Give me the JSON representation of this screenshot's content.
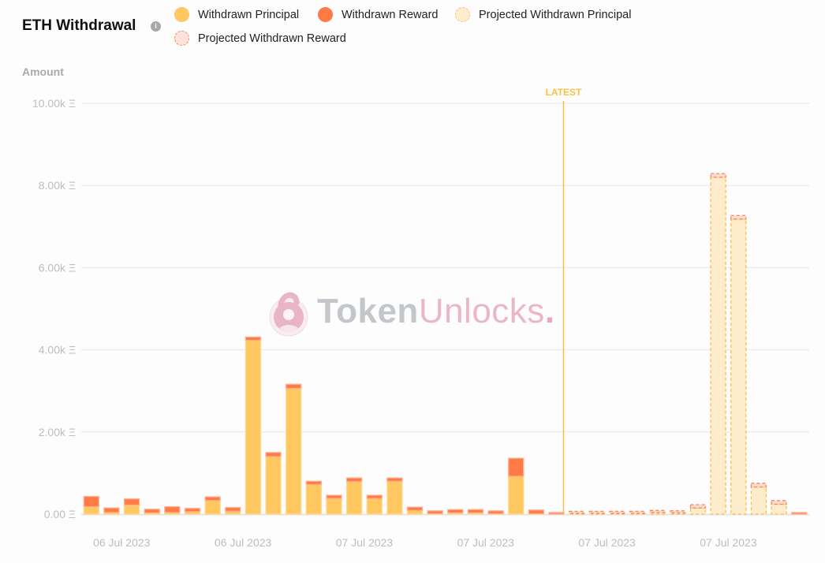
{
  "header": {
    "title": "ETH Withdrawal",
    "info_icon": "info-icon"
  },
  "legend": [
    {
      "label": "Withdrawn Principal",
      "color": "#ffc75f",
      "style": "solid"
    },
    {
      "label": "Withdrawn Reward",
      "color": "#ff7a45",
      "style": "solid"
    },
    {
      "label": "Projected Withdrawn Principal",
      "color": "#ffe9c4",
      "style": "dashed"
    },
    {
      "label": "Projected Withdrawn Reward",
      "color": "#ffe0d6",
      "style": "dashed"
    }
  ],
  "watermark": {
    "part1": "Token",
    "part2": "Unlocks",
    "dot": "."
  },
  "colors": {
    "principal": "#ffc75f",
    "reward": "#ff7a45",
    "projected_principal_fill": "#feeccc",
    "projected_principal_stroke": "#fbbf45",
    "projected_reward_fill": "#fddcd0",
    "projected_reward_stroke": "#f5875f",
    "latest": "#fbbf45",
    "grid": "#e6e6e6",
    "tick_text": "#bdbdbd"
  },
  "chart_data": {
    "type": "bar",
    "stacked": true,
    "title": "ETH Withdrawal",
    "xlabel": "",
    "ylabel": "Amount",
    "ylim": [
      0,
      10000
    ],
    "yticks": [
      0,
      2000,
      4000,
      6000,
      8000,
      10000
    ],
    "ytick_labels": [
      "0.00 Ξ",
      "2.00k Ξ",
      "4.00k Ξ",
      "6.00k Ξ",
      "8.00k Ξ",
      "10.00k Ξ"
    ],
    "grid": true,
    "legend_position": "top",
    "xtick_labels": [
      "06 Jul 2023",
      "06 Jul 2023",
      "07 Jul 2023",
      "07 Jul 2023",
      "07 Jul 2023",
      "07 Jul 2023"
    ],
    "xtick_bar_index": [
      1,
      7,
      13,
      19,
      25,
      31
    ],
    "latest_marker": {
      "label": "LATEST",
      "after_bar_index": 23
    },
    "series": [
      {
        "name": "Withdrawn Principal",
        "values": [
          180,
          40,
          220,
          30,
          40,
          60,
          330,
          70,
          4230,
          1400,
          3060,
          720,
          380,
          790,
          380,
          800,
          90,
          10,
          30,
          30,
          10,
          920,
          10,
          0,
          0,
          0,
          0,
          0,
          0,
          0,
          0,
          0,
          0,
          0,
          0,
          0
        ]
      },
      {
        "name": "Withdrawn Reward",
        "values": [
          250,
          110,
          150,
          90,
          140,
          80,
          90,
          90,
          80,
          100,
          100,
          80,
          80,
          90,
          80,
          80,
          80,
          70,
          80,
          80,
          70,
          440,
          90,
          30,
          0,
          0,
          0,
          0,
          0,
          0,
          0,
          0,
          0,
          0,
          0,
          30
        ]
      },
      {
        "name": "Projected Withdrawn Principal",
        "values": [
          0,
          0,
          0,
          0,
          0,
          0,
          0,
          0,
          0,
          0,
          0,
          0,
          0,
          0,
          0,
          0,
          0,
          0,
          0,
          0,
          0,
          0,
          0,
          0,
          20,
          20,
          20,
          20,
          40,
          30,
          150,
          8200,
          7180,
          660,
          240,
          0
        ]
      },
      {
        "name": "Projected Withdrawn Reward",
        "values": [
          0,
          0,
          0,
          0,
          0,
          0,
          0,
          0,
          0,
          0,
          0,
          0,
          0,
          0,
          0,
          0,
          0,
          0,
          0,
          0,
          0,
          0,
          0,
          0,
          50,
          50,
          50,
          50,
          50,
          50,
          80,
          90,
          90,
          90,
          90,
          0
        ]
      }
    ]
  }
}
